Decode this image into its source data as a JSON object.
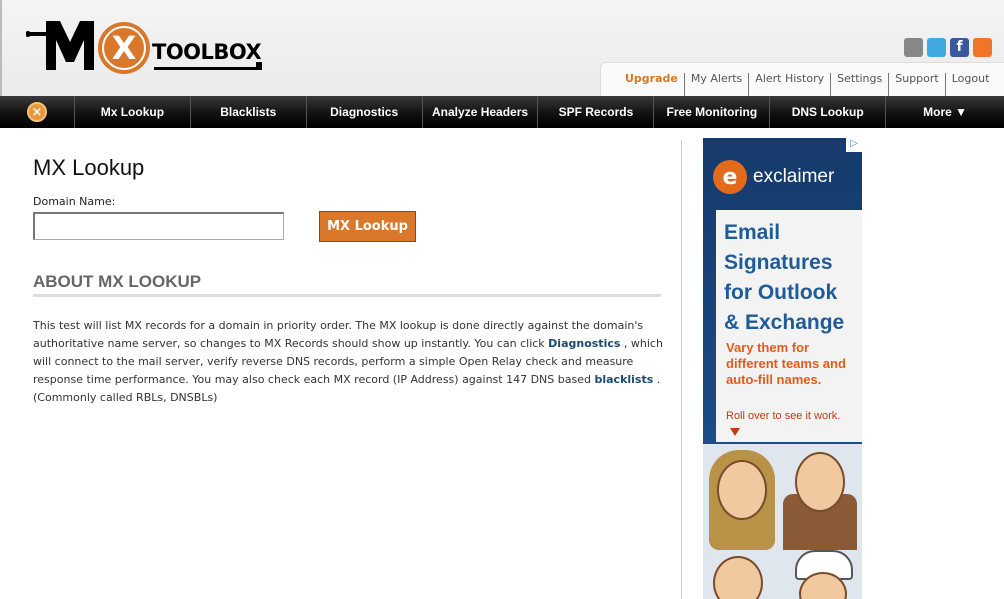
{
  "header": {
    "logo_text": "TOOLBOX",
    "top_links": [
      {
        "label": "Upgrade"
      },
      {
        "label": "My Alerts"
      },
      {
        "label": "Alert History"
      },
      {
        "label": "Settings"
      },
      {
        "label": "Support"
      },
      {
        "label": "Logout"
      }
    ],
    "social_icons": [
      "chat-icon",
      "twitter-icon",
      "facebook-icon",
      "rss-icon"
    ]
  },
  "nav": {
    "items": [
      {
        "label": "Mx Lookup"
      },
      {
        "label": "Blacklists"
      },
      {
        "label": "Diagnostics"
      },
      {
        "label": "Analyze Headers"
      },
      {
        "label": "SPF Records"
      },
      {
        "label": "Free Monitoring"
      },
      {
        "label": "DNS Lookup"
      },
      {
        "label": "More ▼"
      }
    ]
  },
  "main": {
    "title": "MX Lookup",
    "domain_label": "Domain Name:",
    "domain_value": "",
    "button_label": "MX Lookup",
    "about_heading": "ABOUT MX LOOKUP",
    "para_1": "This test will list MX records for a domain in priority order. The MX lookup is done directly against the domain's authoritative name server, so changes to MX Records should show up instantly. You can click",
    "link_diagnostics": "Diagnostics",
    "para_2": ", which will connect to the mail server, verify reverse DNS records, perform a simple Open Relay check and measure response time performance. You may also check each MX record (IP Address) against 147 DNS based",
    "link_blacklists": "blacklists",
    "para_3": ". (Commonly called RBLs, DNSBLs)"
  },
  "ad": {
    "brand": "exclaimer",
    "headline_1": "Email",
    "headline_2": "Signatures",
    "headline_3": "for Outlook",
    "headline_4": "& Exchange",
    "sub": "Vary them for different teams and auto-fill names.",
    "rollover": "Roll over to see it work."
  }
}
